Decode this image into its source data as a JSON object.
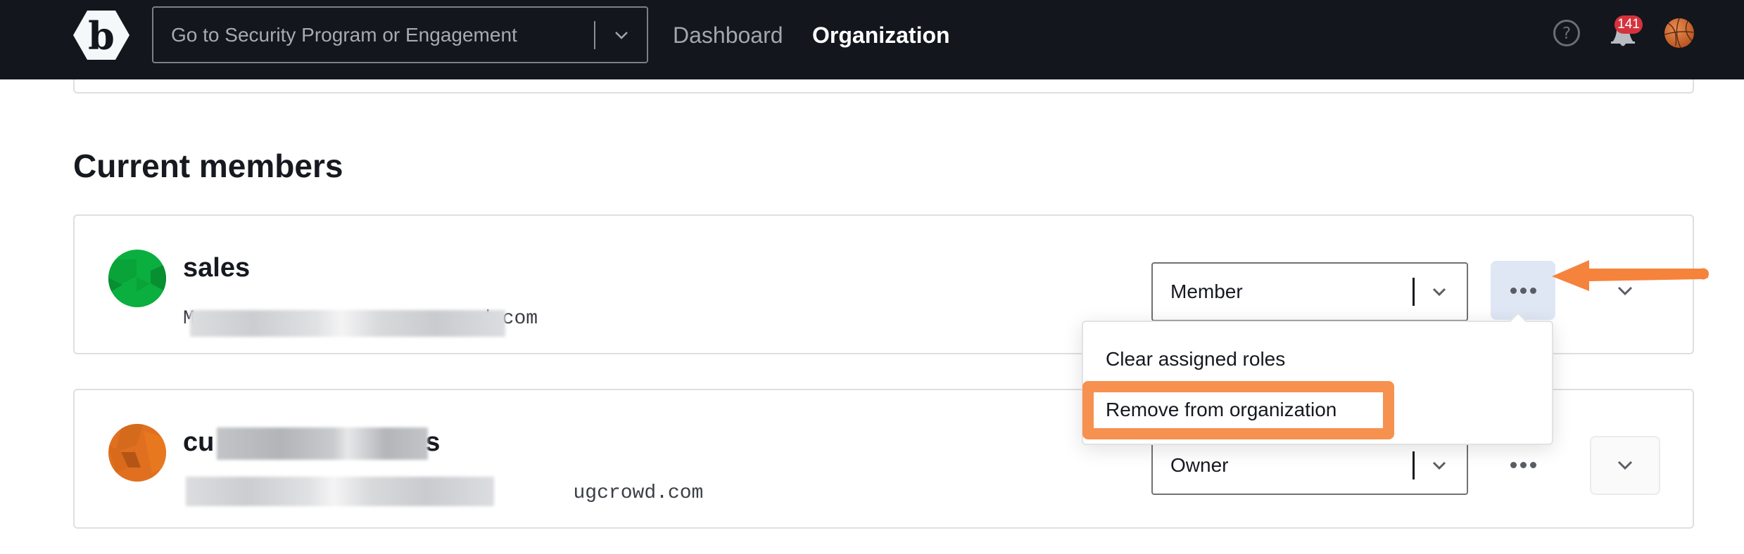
{
  "header": {
    "logo_letter": "b",
    "program_select": {
      "placeholder": "Go to Security Program or Engagement"
    },
    "nav": [
      {
        "label": "Dashboard",
        "active": false
      },
      {
        "label": "Organization",
        "active": true
      }
    ],
    "help_icon": "question-circle-icon",
    "notifications": {
      "icon": "bell-icon",
      "count": "141"
    },
    "user_avatar": "basketball-avatar"
  },
  "section": {
    "title": "Current members"
  },
  "members": [
    {
      "name": "sales",
      "name_redacted": false,
      "email_prefix": "M",
      "email_suffix": "d.com",
      "email_redacted": true,
      "avatar_color": "#0aaf3f",
      "role": "Member",
      "menu_open": true
    },
    {
      "name_prefix": "cu",
      "name_suffix": "is",
      "name_redacted": true,
      "email_prefix": "",
      "email_suffix": "ugcrowd.com",
      "email_redacted": true,
      "avatar_color": "#e07020",
      "role": "Owner",
      "menu_open": false
    }
  ],
  "actions_menu": {
    "items": [
      {
        "label": "Clear assigned roles"
      },
      {
        "label": "Remove from organization",
        "highlighted": true
      }
    ]
  },
  "annotation": {
    "arrow_color": "#f5833c",
    "highlight_color": "#f6914f",
    "arrow_points_to": "more-actions-button (first member)"
  },
  "colors": {
    "header_bg": "#13161c",
    "badge": "#d5333c",
    "active_more_button_bg": "#dfe7f5"
  }
}
